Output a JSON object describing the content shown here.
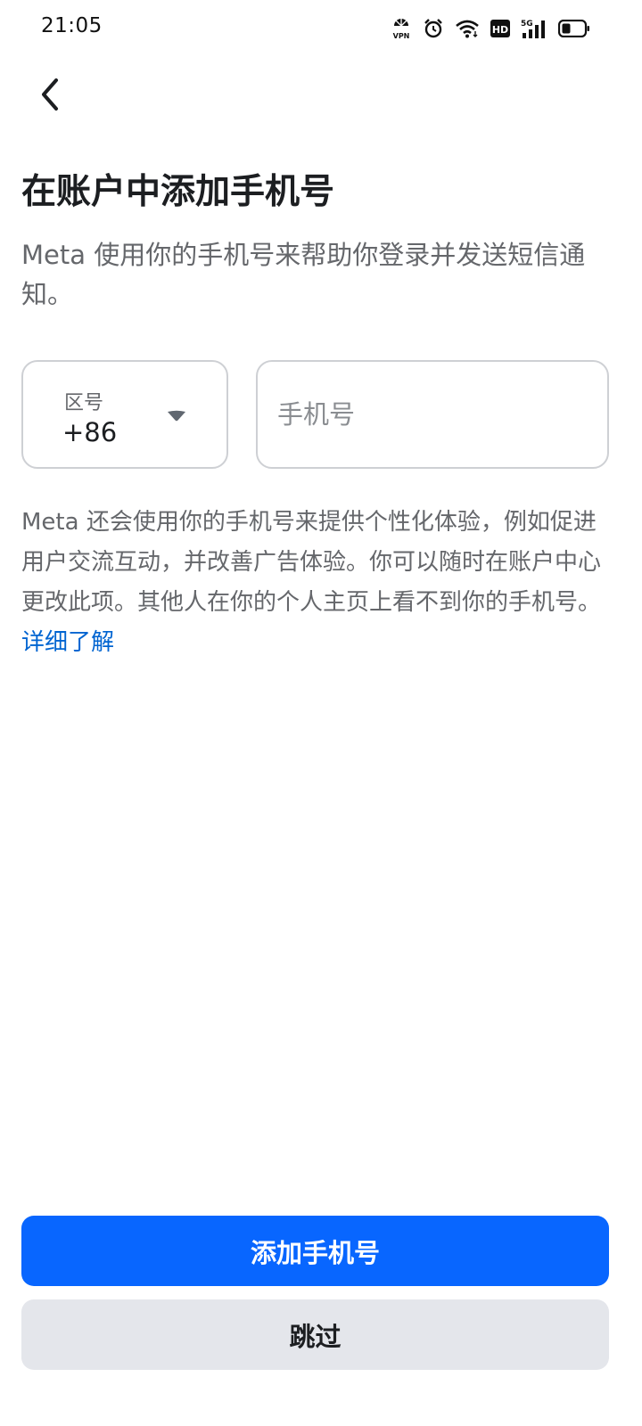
{
  "status_bar": {
    "time": "21:05",
    "icons": [
      "vpn-icon",
      "alarm-icon",
      "wifi-icon",
      "hd-icon",
      "signal-5g-icon",
      "battery-icon"
    ],
    "vpn_label": "VPN",
    "hd_label": "HD",
    "network_label": "5G"
  },
  "header": {
    "back_icon": "chevron-left-icon"
  },
  "main": {
    "title": "在账户中添加手机号",
    "subtitle": "Meta 使用你的手机号来帮助你登录并发送短信通知。",
    "country_code": {
      "label": "区号",
      "value": "+86",
      "icon": "caret-down-icon"
    },
    "phone": {
      "placeholder": "手机号",
      "value": ""
    },
    "info_text": "Meta 还会使用你的手机号来提供个性化体验，例如促进用户交流互动，并改善广告体验。你可以随时在账户中心更改此项。其他人在你的个人主页上看不到你的手机号。",
    "learn_more": "详细了解"
  },
  "footer": {
    "primary_label": "添加手机号",
    "secondary_label": "跳过"
  },
  "colors": {
    "primary": "#0866ff",
    "link": "#0064d1",
    "secondary_bg": "#e4e6eb",
    "muted_text": "#65676b"
  }
}
